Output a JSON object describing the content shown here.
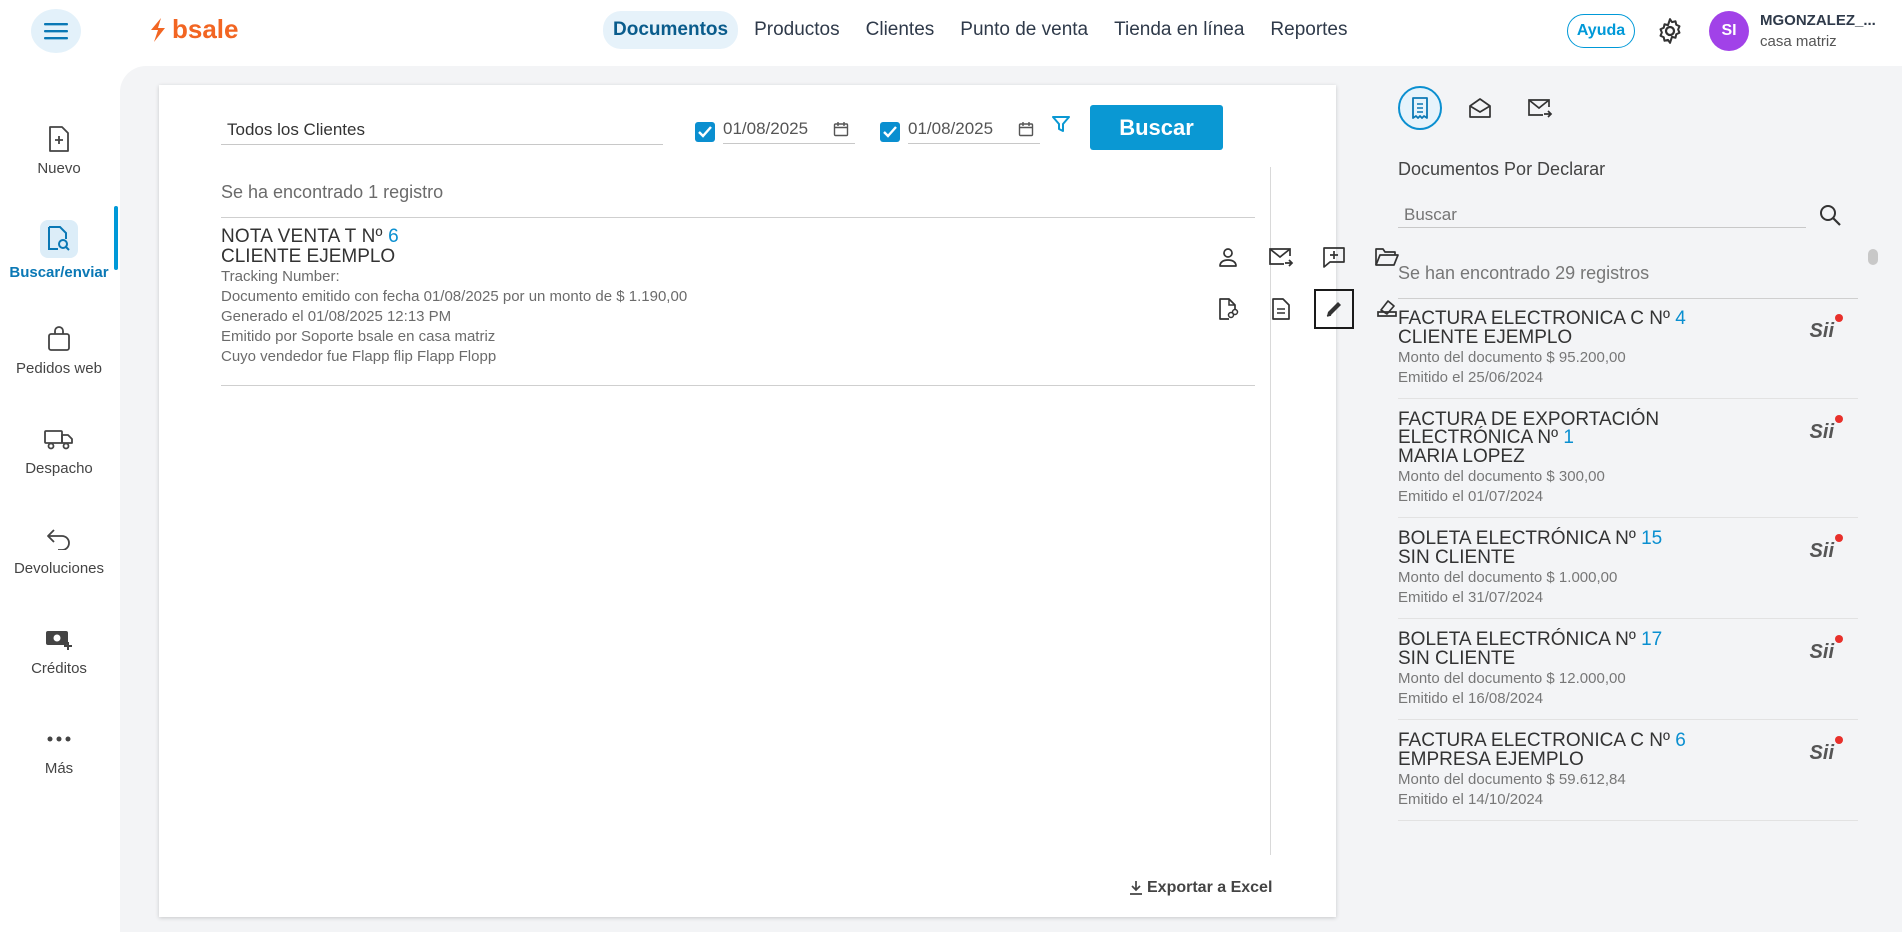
{
  "topbar": {
    "logo_text": "bsale",
    "nav": [
      "Documentos",
      "Productos",
      "Clientes",
      "Punto de venta",
      "Tienda en línea",
      "Reportes"
    ],
    "active_nav": "Documentos",
    "help_label": "Ayuda",
    "avatar_initials": "SI",
    "user_name": "MGONZALEZ_...",
    "user_branch": "casa matriz"
  },
  "sidebar": {
    "items": [
      {
        "label": "Nuevo",
        "icon": "new-document-icon"
      },
      {
        "label": "Buscar/enviar",
        "icon": "search-document-icon",
        "active": true
      },
      {
        "label": "Pedidos web",
        "icon": "shopping-bag-icon"
      },
      {
        "label": "Despacho",
        "icon": "truck-icon"
      },
      {
        "label": "Devoluciones",
        "icon": "return-arrow-icon"
      },
      {
        "label": "Créditos",
        "icon": "money-plus-icon"
      },
      {
        "label": "Más",
        "icon": "more-dots-icon"
      }
    ]
  },
  "search": {
    "client_value": "Todos los Clientes",
    "date_from": "01/08/2025",
    "date_to": "01/08/2025",
    "search_label": "Buscar"
  },
  "results": {
    "found_text": "Se ha encontrado 1 registro",
    "document": {
      "title": "NOTA VENTA T Nº",
      "number": "6",
      "client": "CLIENTE EJEMPLO",
      "lines": [
        "Tracking Number:",
        "Documento emitido con fecha 01/08/2025 por un monto de $ 1.190,00",
        "Generado el 01/08/2025 12:13 PM",
        "Emitido por Soporte bsale en casa matriz",
        "Cuyo vendedor fue Flapp flip Flapp Flopp"
      ]
    },
    "export_label": "Exportar a Excel"
  },
  "right_panel": {
    "title": "Documentos Por Declarar",
    "search_placeholder": "Buscar",
    "found_text": "Se han encontrado 29 registros",
    "items": [
      {
        "title": "FACTURA ELECTRONICA C Nº",
        "number": "4",
        "client": "CLIENTE EJEMPLO",
        "amount": "Monto del documento $ 95.200,00",
        "date": "Emitido el 25/06/2024"
      },
      {
        "title": "FACTURA DE EXPORTACIÓN ELECTRÓNICA Nº",
        "number": "1",
        "client": "MARIA LOPEZ",
        "amount": "Monto del documento $ 300,00",
        "date": "Emitido el 01/07/2024"
      },
      {
        "title": "BOLETA ELECTRÓNICA Nº",
        "number": "15",
        "client": "SIN CLIENTE",
        "amount": "Monto del documento $ 1.000,00",
        "date": "Emitido el 31/07/2024"
      },
      {
        "title": "BOLETA ELECTRÓNICA Nº",
        "number": "17",
        "client": "SIN CLIENTE",
        "amount": "Monto del documento $ 12.000,00",
        "date": "Emitido el 16/08/2024"
      },
      {
        "title": "FACTURA ELECTRONICA C Nº",
        "number": "6",
        "client": "EMPRESA EJEMPLO",
        "amount": "Monto del documento $ 59.612,84",
        "date": "Emitido el 14/10/2024"
      }
    ],
    "badge_text": "Sii"
  },
  "colors": {
    "accent": "#0a98d3",
    "brand": "#f26522",
    "avatar": "#a142e8",
    "badge_dot": "#e8302b"
  }
}
